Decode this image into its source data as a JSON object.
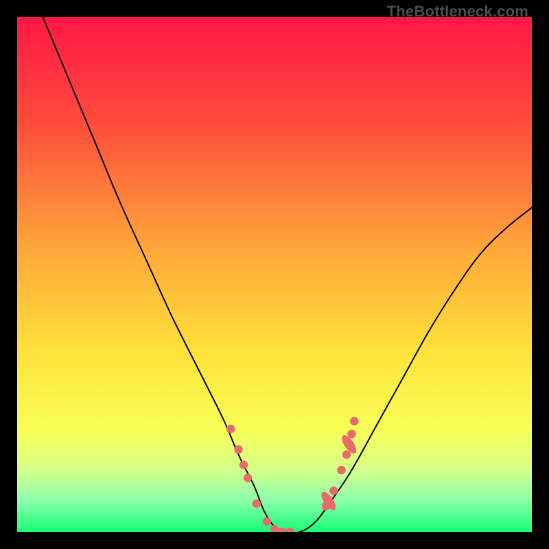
{
  "watermark": "TheBottleneck.com",
  "chart_data": {
    "type": "line",
    "title": "",
    "xlabel": "",
    "ylabel": "",
    "xlim": [
      0,
      100
    ],
    "ylim": [
      0,
      100
    ],
    "gradient_stops": [
      {
        "offset": 0,
        "color": "#ff1846"
      },
      {
        "offset": 20,
        "color": "#ff4a3b"
      },
      {
        "offset": 45,
        "color": "#ffa73a"
      },
      {
        "offset": 65,
        "color": "#ffe23a"
      },
      {
        "offset": 80,
        "color": "#f7ff55"
      },
      {
        "offset": 88,
        "color": "#d6ff8a"
      },
      {
        "offset": 94,
        "color": "#8affad"
      },
      {
        "offset": 100,
        "color": "#17ff74"
      }
    ],
    "series": [
      {
        "name": "bottleneck-curve",
        "type": "line",
        "stroke": "#000000",
        "stroke_width": 2.0,
        "x": [
          5,
          10,
          15,
          20,
          25,
          30,
          35,
          40,
          43,
          46,
          48,
          50,
          52,
          55,
          58,
          61,
          65,
          70,
          75,
          80,
          85,
          90,
          95,
          100
        ],
        "y": [
          100,
          88,
          76,
          64,
          53,
          42,
          32,
          22,
          15,
          9,
          4,
          1,
          0,
          0,
          2,
          6,
          12,
          21,
          30,
          39,
          47,
          54,
          59,
          63
        ]
      },
      {
        "name": "left-cluster-markers",
        "type": "scatter",
        "color": "#e86a6a",
        "marker_size": 10,
        "x": [
          41.5,
          43.0,
          44.0,
          44.8,
          46.5,
          48.5,
          50.0,
          51.5,
          53.0
        ],
        "y": [
          20.0,
          16.0,
          13.0,
          10.5,
          5.5,
          2.0,
          0.5,
          0.0,
          0.0
        ]
      },
      {
        "name": "right-cluster-markers",
        "type": "scatter",
        "color": "#e86a6a",
        "marker_size": 10,
        "x": [
          60.0,
          61.5,
          63.0,
          64.0,
          65.0,
          65.5
        ],
        "y": [
          5.0,
          8.0,
          12.0,
          15.0,
          19.0,
          21.5
        ]
      },
      {
        "name": "right-cluster-caps",
        "type": "scatter",
        "color": "#e86a6a",
        "shape": "ellipse-wide",
        "marker_size": 12,
        "x": [
          60.5,
          64.5
        ],
        "y": [
          6.0,
          17.0
        ]
      }
    ]
  }
}
